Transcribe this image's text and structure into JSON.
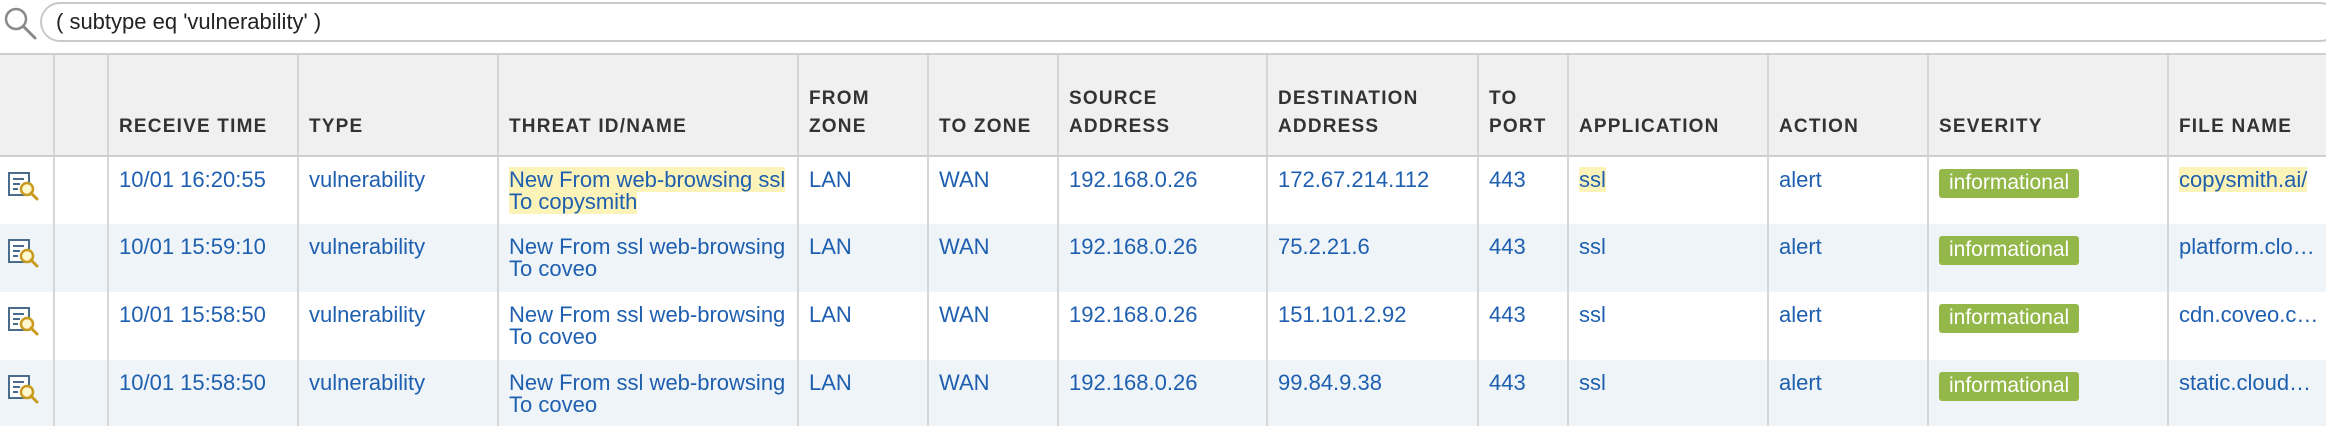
{
  "filter": {
    "query": "( subtype eq 'vulnerability' )"
  },
  "columns": [
    "",
    "",
    "RECEIVE TIME",
    "TYPE",
    "THREAT ID/NAME",
    "FROM ZONE",
    "TO ZONE",
    "SOURCE ADDRESS",
    "DESTINATION ADDRESS",
    "TO PORT",
    "APPLICATION",
    "ACTION",
    "SEVERITY",
    "FILE NAME"
  ],
  "rows": [
    {
      "receive_time": "10/01 16:20:55",
      "type": "vulnerability",
      "threat": "New From web-browsing ssl To copysmith",
      "from_zone": "LAN",
      "to_zone": "WAN",
      "source": "192.168.0.26",
      "destination": "172.67.214.112",
      "port": "443",
      "application": "ssl",
      "action": "alert",
      "severity": "informational",
      "file_name": "copysmith.ai/"
    },
    {
      "receive_time": "10/01 15:59:10",
      "type": "vulnerability",
      "threat": "New From ssl web-browsing To coveo",
      "from_zone": "LAN",
      "to_zone": "WAN",
      "source": "192.168.0.26",
      "destination": "75.2.21.6",
      "port": "443",
      "application": "ssl",
      "action": "alert",
      "severity": "informational",
      "file_name": "platform.clo…"
    },
    {
      "receive_time": "10/01 15:58:50",
      "type": "vulnerability",
      "threat": "New From ssl web-browsing To coveo",
      "from_zone": "LAN",
      "to_zone": "WAN",
      "source": "192.168.0.26",
      "destination": "151.101.2.92",
      "port": "443",
      "application": "ssl",
      "action": "alert",
      "severity": "informational",
      "file_name": "cdn.coveo.c…"
    },
    {
      "receive_time": "10/01 15:58:50",
      "type": "vulnerability",
      "threat": "New From ssl web-browsing To coveo",
      "from_zone": "LAN",
      "to_zone": "WAN",
      "source": "192.168.0.26",
      "destination": "99.84.9.38",
      "port": "443",
      "application": "ssl",
      "action": "alert",
      "severity": "informational",
      "file_name": "static.cloud…"
    }
  ],
  "colors": {
    "link": "#1f5fb0",
    "severity_informational": "#93b849",
    "row_alt": "#eef4f8",
    "highlight": "#fbf3b8"
  },
  "icons": {
    "search": "search-icon",
    "row_detail": "log-detail-icon"
  }
}
